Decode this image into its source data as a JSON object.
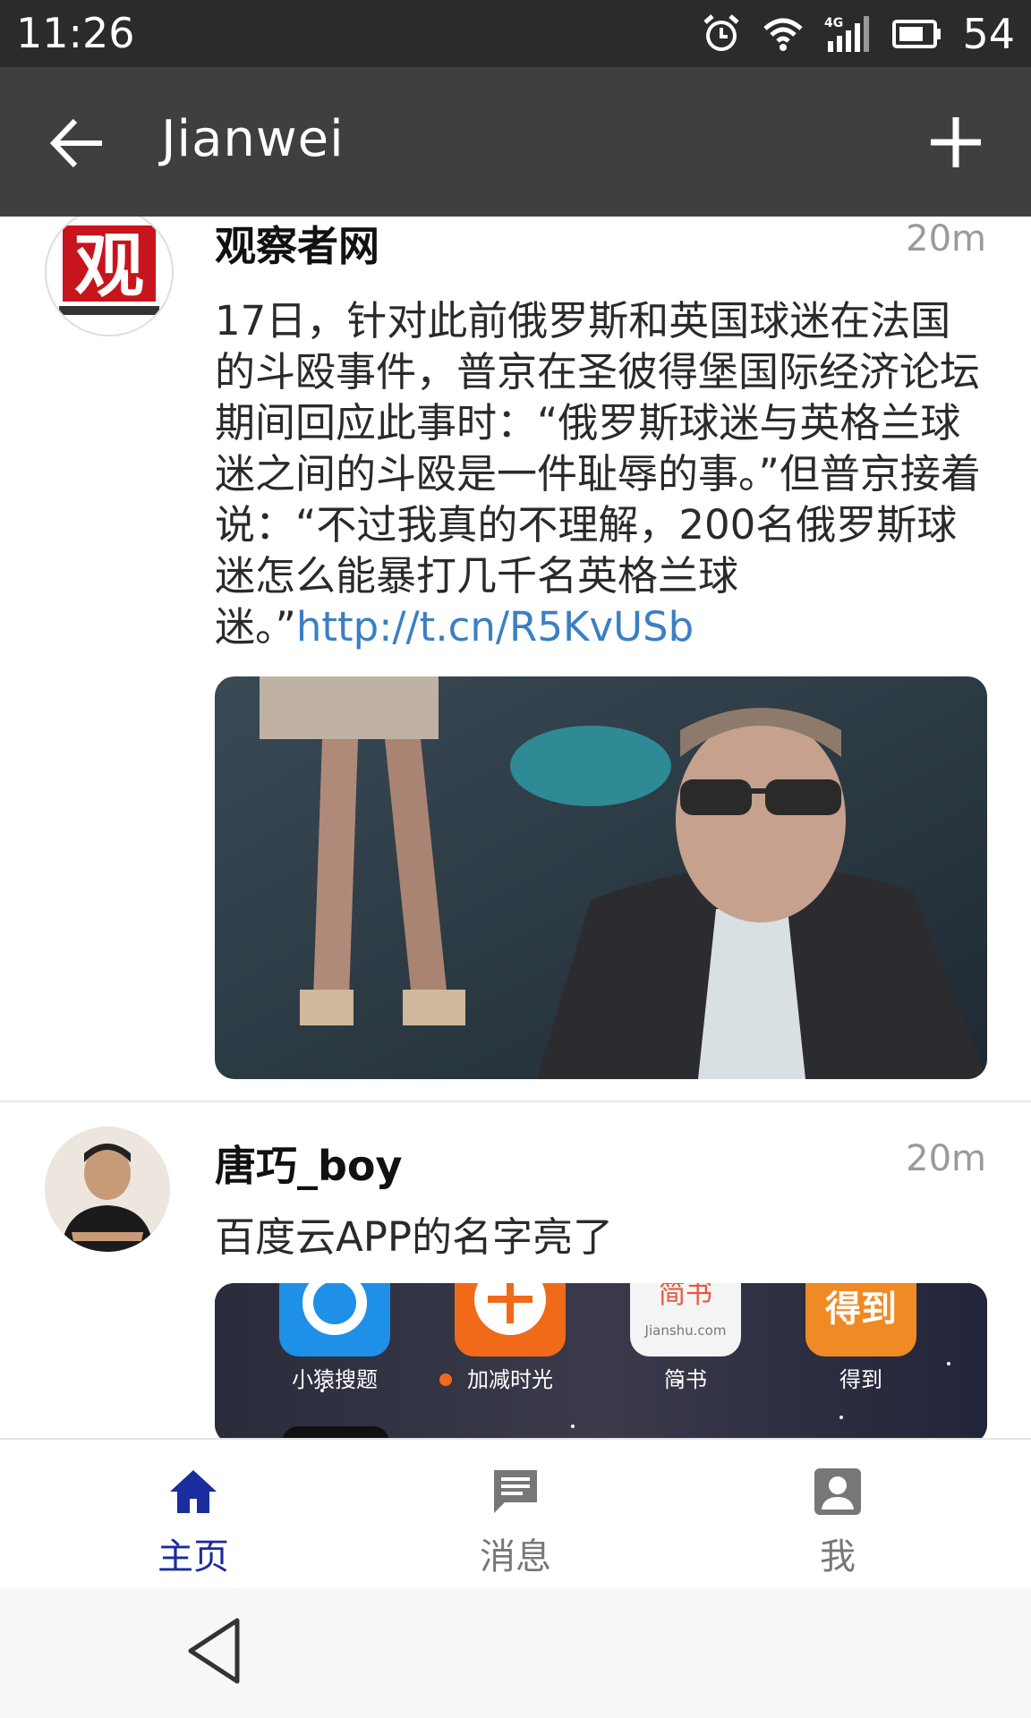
{
  "status_bar": {
    "time": "11:26",
    "battery": "54"
  },
  "app_bar": {
    "title": "Jianwei"
  },
  "posts": [
    {
      "author": "观察者网",
      "time": "20m",
      "text": "17日，针对此前俄罗斯和英国球迷在法国的斗殴事件，普京在圣彼得堡国际经济论坛期间回应此事时：“俄罗斯球迷与英格兰球迷之间的斗殴是一件耻辱的事。”但普京接着说：“不过我真的不理解，200名俄罗斯球迷怎么能暴打几千名英格兰球迷。”",
      "link": "http://t.cn/R5KvUSb",
      "avatar_text": "观"
    },
    {
      "author": "唐巧_boy",
      "time": "20m",
      "text": "百度云APP的名字亮了",
      "apps": [
        {
          "label": "小猿搜题",
          "color": "#1e90e8",
          "icon_text": "Q"
        },
        {
          "label": "加减时光",
          "color": "#f06a1a",
          "icon_text": "十"
        },
        {
          "label": "简书",
          "color": "#f4f4f4",
          "icon_text": "简书",
          "sub_text": "Jianshu.com"
        },
        {
          "label": "得到",
          "color": "#f08a24",
          "icon_text": "得到"
        }
      ]
    }
  ],
  "tabs": [
    {
      "label": "主页",
      "icon": "home-icon",
      "active": true
    },
    {
      "label": "消息",
      "icon": "message-icon",
      "active": false
    },
    {
      "label": "我",
      "icon": "profile-icon",
      "active": false
    }
  ],
  "colors": {
    "accent": "#1a2d9c",
    "link": "#3a7fc3",
    "app_bar": "#3f3f3f",
    "status_bar": "#2b2b2b"
  }
}
